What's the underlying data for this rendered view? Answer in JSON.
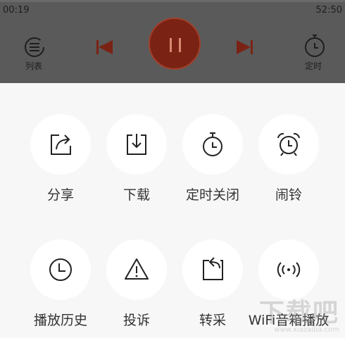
{
  "player": {
    "elapsed": "00:19",
    "duration": "52:50",
    "playlist_label": "列表",
    "timer_label": "定时"
  },
  "sheet": {
    "items": [
      {
        "label": "分享",
        "icon": "share-icon"
      },
      {
        "label": "下载",
        "icon": "download-icon"
      },
      {
        "label": "定时关闭",
        "icon": "stopwatch-icon"
      },
      {
        "label": "闹铃",
        "icon": "alarm-clock-icon"
      },
      {
        "label": "播放历史",
        "icon": "clock-icon"
      },
      {
        "label": "投诉",
        "icon": "warning-icon"
      },
      {
        "label": "转采",
        "icon": "repost-icon"
      },
      {
        "label": "WiFi音箱播放",
        "icon": "wifi-speaker-icon"
      }
    ]
  },
  "watermark": {
    "big": "下载吧",
    "small": "www.xiazaiba.com"
  },
  "colors": {
    "accent": "#7a2314",
    "overlay": "#5a5a5a",
    "sheet_bg": "#f7f7f7",
    "icon": "#222222"
  }
}
